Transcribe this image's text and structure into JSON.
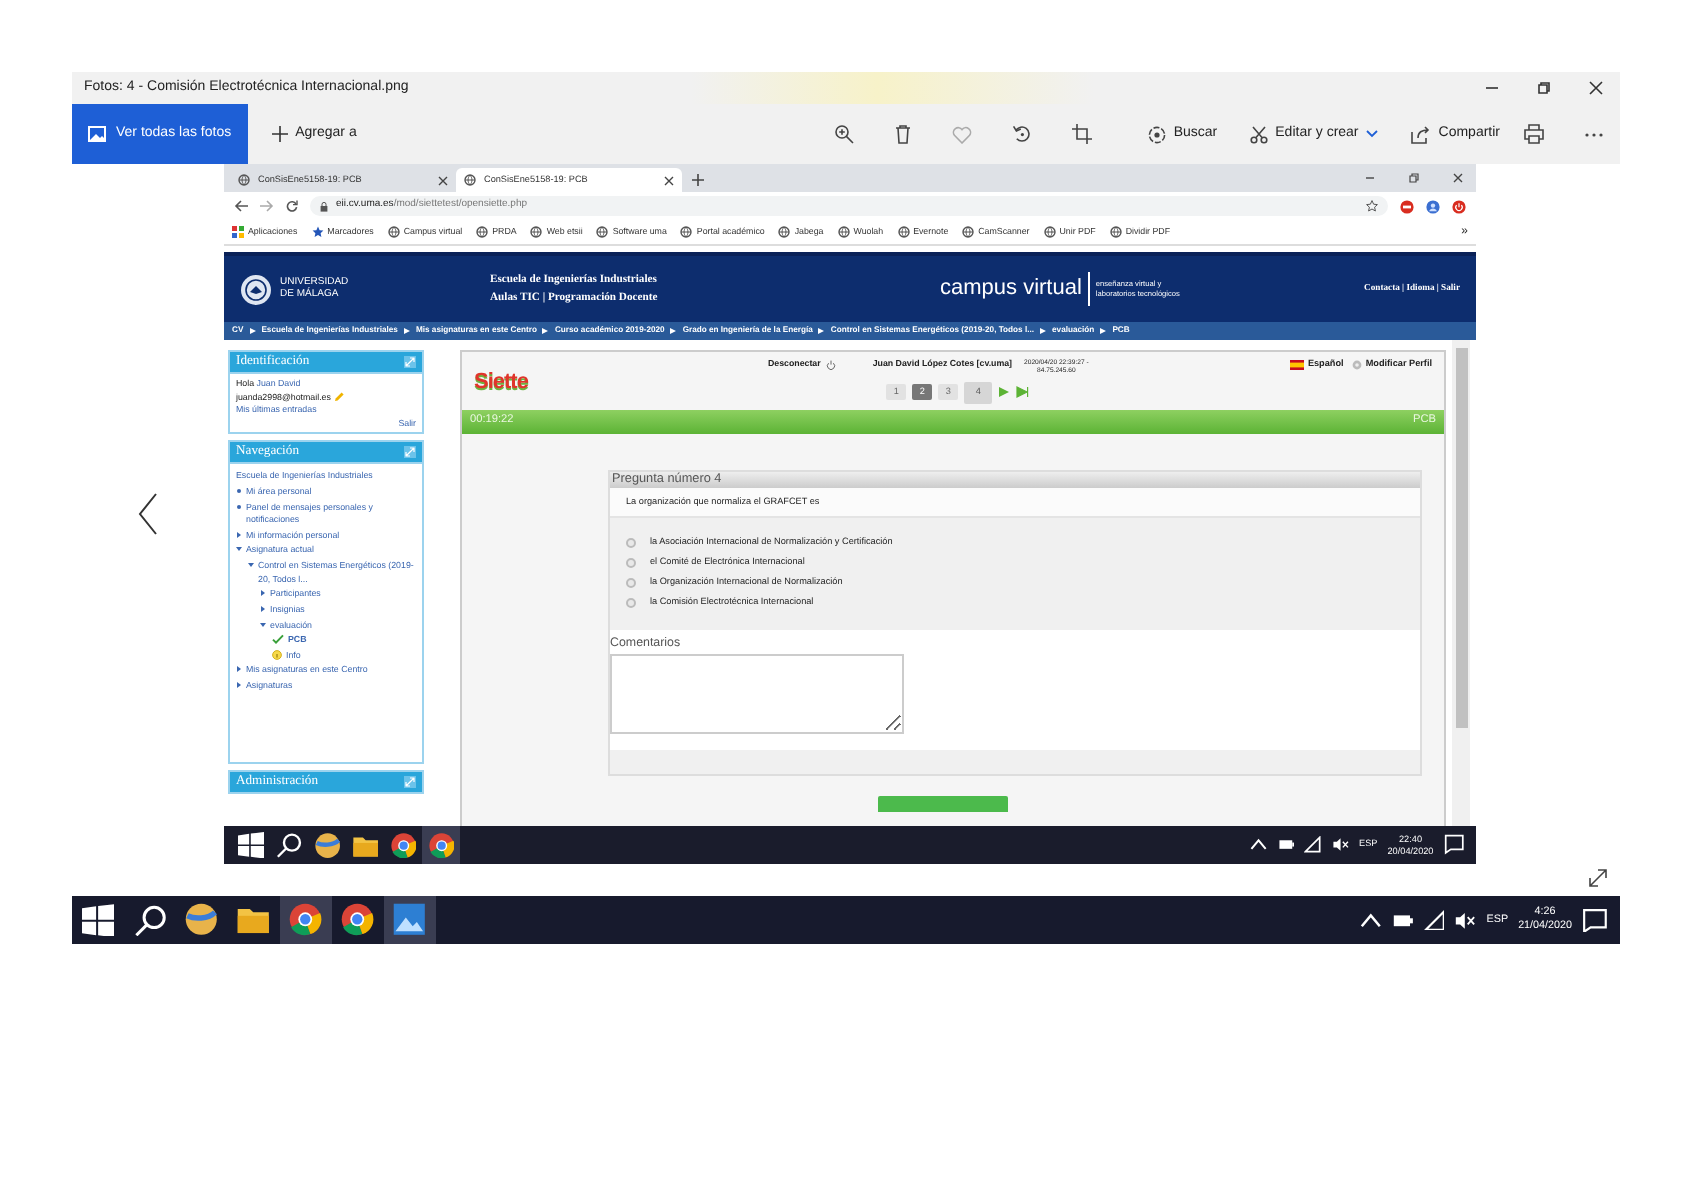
{
  "photos_window": {
    "title": "Fotos: 4 - Comisión Electrotécnica Internacional.png",
    "toolbar": {
      "view_all": "Ver todas las fotos",
      "add_to": "Agregar a",
      "search": "Buscar",
      "edit_create": "Editar y crear",
      "share": "Compartir"
    }
  },
  "browser": {
    "tabs": [
      {
        "label": "ConSisEne5158-19: PCB",
        "selected": false
      },
      {
        "label": "ConSisEne5158-19: PCB",
        "selected": true
      }
    ],
    "address": {
      "host": "eii.cv.uma.es",
      "path": "/mod/siettetest/opensiette.php"
    },
    "bookmarks": [
      "Aplicaciones",
      "Marcadores",
      "Campus virtual",
      "PRDA",
      "Web etsii",
      "Software uma",
      "Portal académico",
      "Jabega",
      "Wuolah",
      "Evernote",
      "CamScanner",
      "Unir PDF",
      "Dividir PDF"
    ],
    "bookmarks_more": "»"
  },
  "site_header": {
    "university": [
      "UNIVERSIDAD",
      "DE MÁLAGA"
    ],
    "school": "Escuela de Ingenierías Industriales",
    "school_links": "Aulas TIC | Programación Docente",
    "campus": "campus virtual",
    "campus_tagline": [
      "enseñanza virtual y",
      "laboratorios tecnológicos"
    ],
    "links": "Contacta | Idioma | Salir"
  },
  "breadcrumb": [
    "CV",
    "Escuela de Ingenierías Industriales",
    "Mis asignaturas en este Centro",
    "Curso académico 2019-2020",
    "Grado en Ingeniería de la Energía",
    "Control en Sistemas Energéticos (2019-20, Todos l...",
    "evaluación",
    "PCB"
  ],
  "sidebar": {
    "identification": {
      "title": "Identificación",
      "greeting": "Hola",
      "user": "Juan David",
      "email": "juanda2998@hotmail.es",
      "recent": "Mis últimas entradas",
      "logout": "Salir"
    },
    "navigation": {
      "title": "Navegación",
      "items": [
        {
          "kind": "root",
          "label": "Escuela de Ingenierías Industriales"
        },
        {
          "kind": "bullet",
          "label": "Mi área personal"
        },
        {
          "kind": "bullet",
          "label": "Panel de mensajes personales y notificaciones"
        },
        {
          "kind": "branch",
          "label": "Mi información personal",
          "expanded": false
        },
        {
          "kind": "branch",
          "label": "Asignatura actual",
          "expanded": true,
          "children": [
            {
              "kind": "branch",
              "label": "Control en Sistemas Energéticos (2019-20, Todos l...",
              "expanded": true,
              "children": [
                {
                  "kind": "branch",
                  "label": "Participantes",
                  "expanded": false
                },
                {
                  "kind": "branch",
                  "label": "Insignias",
                  "expanded": false
                },
                {
                  "kind": "branch",
                  "label": "evaluación",
                  "expanded": true,
                  "children": [
                    {
                      "kind": "check",
                      "label": "PCB"
                    },
                    {
                      "kind": "info",
                      "label": "Info"
                    }
                  ]
                }
              ]
            }
          ]
        },
        {
          "kind": "branch",
          "label": "Mis asignaturas en este Centro",
          "expanded": false
        },
        {
          "kind": "branch",
          "label": "Asignaturas",
          "expanded": false
        }
      ]
    },
    "administration": {
      "title": "Administración"
    }
  },
  "siette": {
    "logo": "Siette",
    "disconnect": "Desconectar",
    "user": "Juan David López Cotes [cv.uma]",
    "session": "2020/04/20 22:39:27 -",
    "ip": "84.75.245.60",
    "language": "Español",
    "profile": "Modificar Perfil",
    "pages": [
      {
        "label": "1",
        "selected": false,
        "answered": false
      },
      {
        "label": "2",
        "selected": false,
        "answered": true
      },
      {
        "label": "3",
        "selected": false,
        "answered": false
      },
      {
        "label": "4",
        "selected": true,
        "answered": false
      }
    ],
    "timer": "00:19:22",
    "test": "PCB",
    "question": {
      "title": "Pregunta número 4",
      "text": "La organización que normaliza el GRAFCET es",
      "options": [
        {
          "label": "la Asociación Internacional de Normalización y Certificación",
          "selected": false
        },
        {
          "label": "el Comité de Electrónica Internacional",
          "selected": false
        },
        {
          "label": "la Organización Internacional de Normalización",
          "selected": false
        },
        {
          "label": "la Comisión Electrotécnica Internacional",
          "selected": false
        }
      ],
      "comments_label": "Comentarios"
    }
  },
  "inner_taskbar": {
    "apps": [
      {
        "kind": "globe",
        "active": false
      },
      {
        "kind": "folder",
        "active": false
      },
      {
        "kind": "chrome",
        "active": false
      },
      {
        "kind": "chrome",
        "active": true
      }
    ],
    "language": "ESP",
    "time": "22:40",
    "date": "20/04/2020"
  },
  "taskbar": {
    "apps": [
      {
        "kind": "globe",
        "active": false
      },
      {
        "kind": "folder",
        "active": false
      },
      {
        "kind": "chrome",
        "active": true
      },
      {
        "kind": "chrome",
        "active": false
      },
      {
        "kind": "photos",
        "active": true
      }
    ],
    "language": "ESP",
    "time": "4:26",
    "date": "21/04/2020"
  }
}
